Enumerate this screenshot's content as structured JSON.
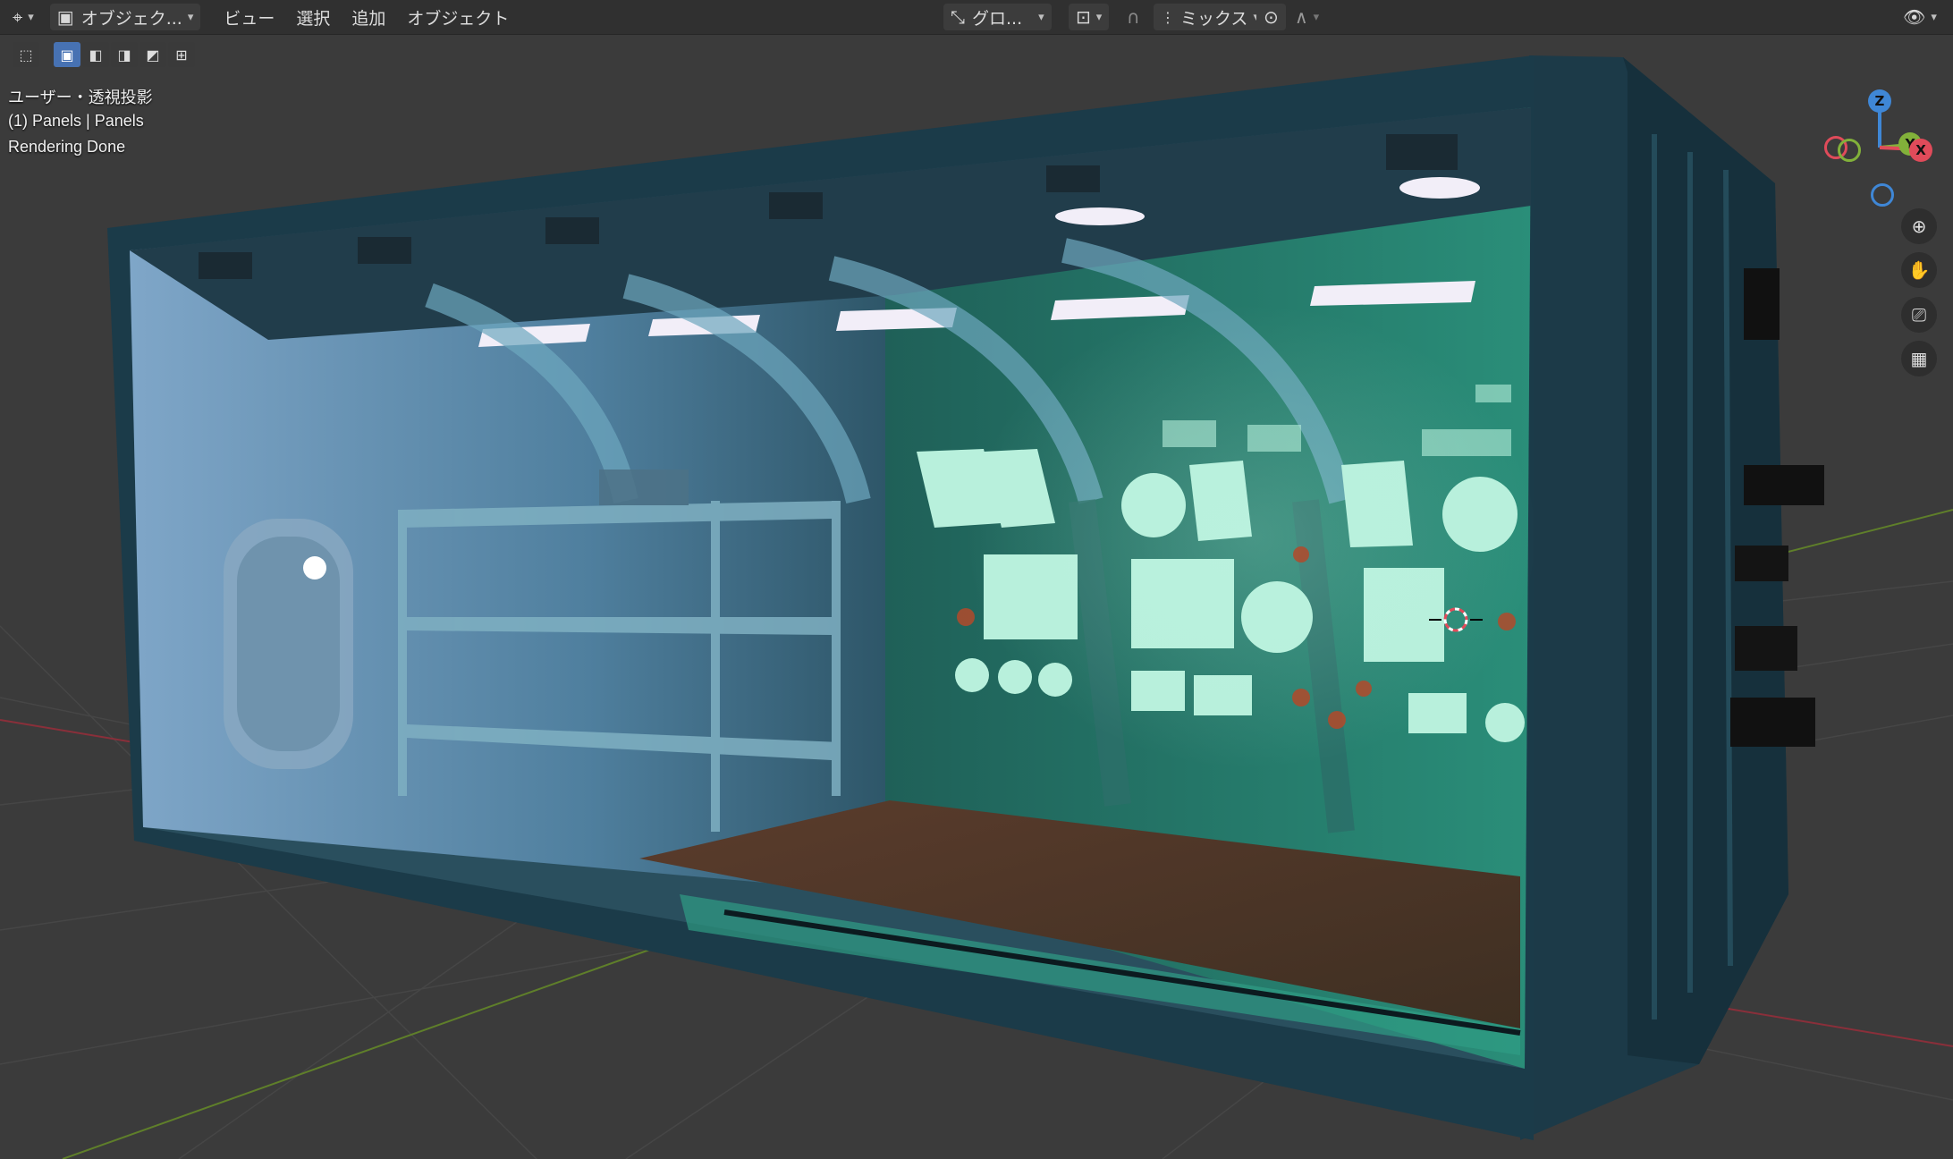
{
  "header": {
    "editor_type_icon": "viewport-editor-icon",
    "mode_label": "オブジェク...",
    "menus": [
      "ビュー",
      "選択",
      "追加",
      "オブジェクト"
    ],
    "transform_orientation": "グロ...",
    "snap_mode": "ミックス"
  },
  "overlay": {
    "view_name": "ユーザー・透視投影",
    "object_info": "(1) Panels | Panels",
    "status": "Rendering Done"
  },
  "gizmo": {
    "z": "Z",
    "y": "Y",
    "x": "X"
  },
  "nav_icons": [
    "zoom-icon",
    "hand-pan-icon",
    "camera-icon",
    "grid-perspective-icon"
  ],
  "colors": {
    "header_bg": "#303030",
    "viewport_bg": "#3b3b3b",
    "accent_blue": "#4772b3",
    "axis_x": "#e04b5a",
    "axis_y": "#82b13a",
    "axis_z": "#3f87d6",
    "container_frame": "#1a3a47",
    "screen_glow": "#b8f0dc"
  }
}
